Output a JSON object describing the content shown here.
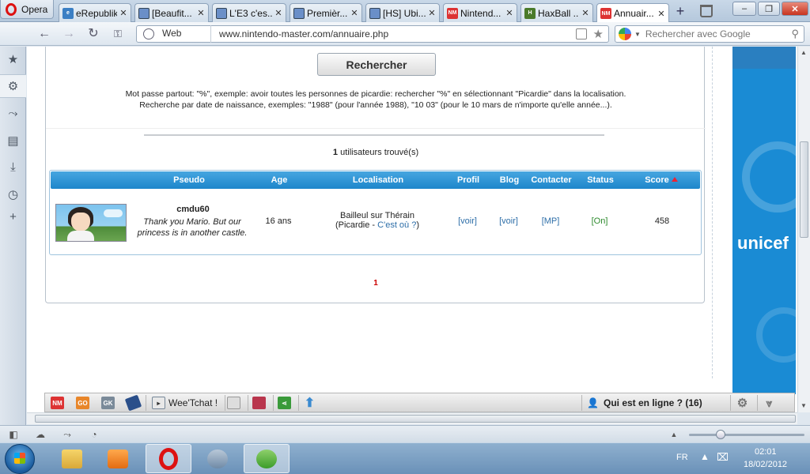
{
  "browser": {
    "menu_label": "Opera",
    "tabs": [
      {
        "title": "eRepublik",
        "favicon": "erepublik-icon",
        "active": false
      },
      {
        "title": "[Beaufit...",
        "favicon": "gamepad-icon",
        "active": false
      },
      {
        "title": "L'E3 c'es...",
        "favicon": "gamepad-icon",
        "active": false
      },
      {
        "title": "Premièr...",
        "favicon": "gamepad-icon",
        "active": false
      },
      {
        "title": "[HS] Ubi...",
        "favicon": "gamepad-icon",
        "active": false
      },
      {
        "title": "Nintend...",
        "favicon": "nm-icon",
        "active": false
      },
      {
        "title": "HaxBall ...",
        "favicon": "haxball-icon",
        "active": false
      },
      {
        "title": "Annuair...",
        "favicon": "nm-icon",
        "active": true
      }
    ],
    "fav_texts": {
      "nm": "NM",
      "hb": "H"
    },
    "address": {
      "scheme_label": "Web",
      "url": "www.nintendo-master.com/annuaire.php"
    },
    "search": {
      "placeholder": "Rechercher avec Google"
    }
  },
  "page": {
    "search_button": "Rechercher",
    "help_line1": "Mot passe partout: \"%\", exemple: avoir toutes les personnes de picardie: rechercher \"%\" en sélectionnant \"Picardie\" dans la localisation.",
    "help_line2": "Recherche par date de naissance, exemples: \"1988\" (pour l'année 1988), \"10 03\" (pour le 10 mars de n'importe qu'elle année...).",
    "found_count": "1",
    "found_text": " utilisateurs trouvé(s)",
    "table": {
      "headers": {
        "pseudo": "Pseudo",
        "age": "Age",
        "localisation": "Localisation",
        "profil": "Profil",
        "blog": "Blog",
        "contacter": "Contacter",
        "status": "Status",
        "score": "Score"
      },
      "row": {
        "pseudo": "cmdu60",
        "quote": "Thank you Mario. But our princess is in another castle.",
        "age": "16 ans",
        "loc_city": "Bailleul sur Thérain",
        "loc_region_prefix": "(Picardie - ",
        "loc_link": "C'est où ?",
        "loc_suffix": ")",
        "profil": "[voir]",
        "blog": "[voir]",
        "contacter": "[MP]",
        "status": "[On]",
        "score": "458"
      }
    },
    "pager": "1",
    "ad_text": "unicef"
  },
  "widget_bar": {
    "icons": [
      {
        "text": "NM"
      },
      {
        "text": "GO"
      },
      {
        "text": "GK"
      }
    ],
    "chat_label": "Wee'Tchat !",
    "online_label": "Qui est en ligne ? (16)"
  },
  "taskbar": {
    "lang": "FR",
    "time": "02:01",
    "date": "18/02/2012"
  },
  "colors": {
    "header_blue": "#1d86cb",
    "link": "#2d6ea8",
    "status_on": "#2d8a2d",
    "pager": "#cc0000"
  }
}
